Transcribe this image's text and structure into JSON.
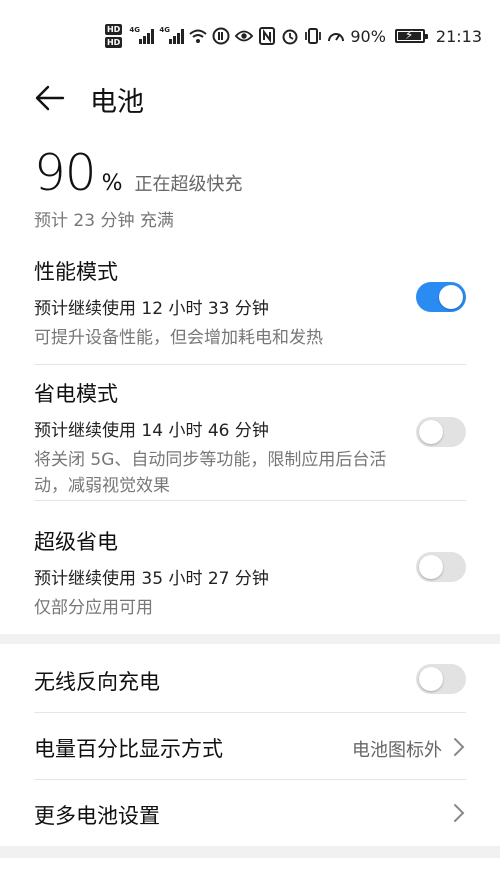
{
  "status": {
    "battery_pct": "90%",
    "time": "21:13",
    "net1": "4G",
    "net2": "4G",
    "hd1": "HD",
    "hd2": "HD"
  },
  "header": {
    "title": "电池"
  },
  "battery": {
    "level": "90",
    "unit": "%",
    "state": "正在超级快充",
    "eta": "预计 23 分钟 充满"
  },
  "modes": [
    {
      "title": "性能模式",
      "estimate": "预计继续使用 12 小时 33 分钟",
      "desc": "可提升设备性能，但会增加耗电和发热",
      "enabled": true
    },
    {
      "title": "省电模式",
      "estimate": "预计继续使用 14 小时 46 分钟",
      "desc": "将关闭 5G、自动同步等功能，限制应用后台活动，减弱视觉效果",
      "enabled": false
    },
    {
      "title": "超级省电",
      "estimate": "预计继续使用 35 小时 27 分钟",
      "desc": "仅部分应用可用",
      "enabled": false
    }
  ],
  "settings": {
    "wireless_reverse": {
      "title": "无线反向充电",
      "enabled": false
    },
    "percent_display": {
      "title": "电量百分比显示方式",
      "value": "电池图标外"
    },
    "more": {
      "title": "更多电池设置"
    }
  },
  "colors": {
    "accent": "#2a8bf2",
    "toggle_off": "#e2e2e2",
    "band": "#f1f1f1"
  }
}
